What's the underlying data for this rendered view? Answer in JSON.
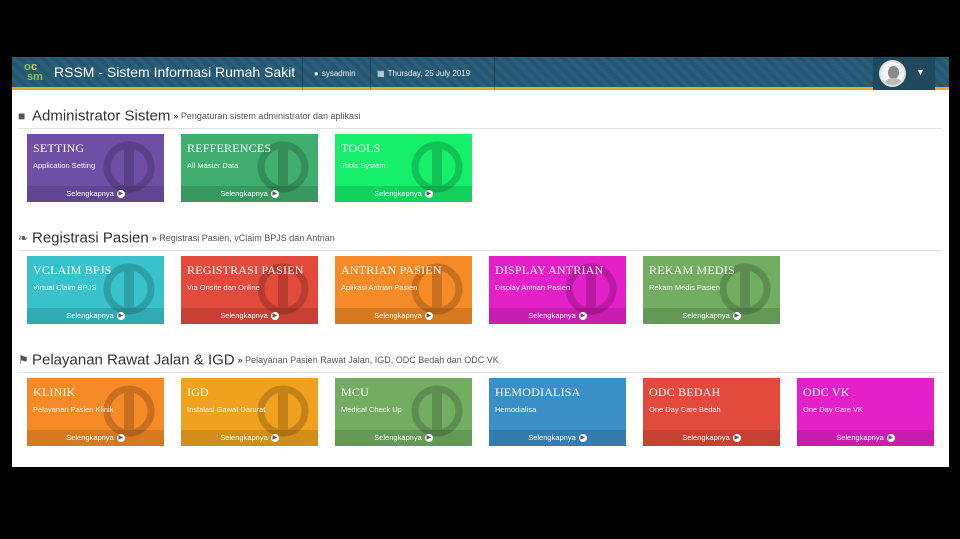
{
  "app": {
    "logo_text": "sm",
    "title": "RSSM - Sistem Informasi Rumah Sakit",
    "user_icon": "user-icon",
    "user": "sysadmin",
    "date_icon": "calendar-icon",
    "date": "Thursday, 25 July 2019"
  },
  "more_label": "Selengkapnya",
  "sections": [
    {
      "icon": "bookmark-icon",
      "title": "Administrator Sistem",
      "subtitle": "Pengaturan sistem administrator dan aplikasi",
      "tiles": [
        {
          "title": "SETTING",
          "sub": "Application Setting",
          "color": "#6f4fa5",
          "icon": "gears-icon"
        },
        {
          "title": "REFFERENCES",
          "sub": "All Master Data",
          "color": "#3fae6e",
          "icon": "table-icon"
        },
        {
          "title": "TOOLS",
          "sub": "Tools System",
          "color": "#15ef6a",
          "icon": "tools-icon"
        }
      ]
    },
    {
      "icon": "leaf-icon",
      "title": "Registrasi Pasien",
      "subtitle": "Registrasi Pasien, vClaim BPJS dan Antrian",
      "tiles": [
        {
          "title": "VCLAIM BPJS",
          "sub": "Virtual Claim BPJS",
          "color": "#38c3cc",
          "icon": "globe-icon"
        },
        {
          "title": "REGISTRASI PASIEN",
          "sub": "Via Onsite dan Online",
          "color": "#e24b3b",
          "icon": "edit-icon"
        },
        {
          "title": "ANTRIAN PASIEN",
          "sub": "Aplikasi Antrian Pasien",
          "color": "#f58a26",
          "icon": "list-icon"
        },
        {
          "title": "DISPLAY ANTRIAN",
          "sub": "Display Antrian Pasien",
          "color": "#e421c8",
          "icon": "monitor-icon"
        },
        {
          "title": "REKAM MEDIS",
          "sub": "Rekam Medis Pasien",
          "color": "#72ad62",
          "icon": "stethoscope-icon"
        }
      ]
    },
    {
      "icon": "flag-icon",
      "title": "Pelayanan Rawat Jalan & IGD",
      "subtitle": "Pelayanan Pasien Rawat Jalan, IGD, ODC Bedah dan ODC VK",
      "tiles": [
        {
          "title": "KLINIK",
          "sub": "Pelayanan Pasien Klinik",
          "color": "#f58a26",
          "icon": "asterisk-icon"
        },
        {
          "title": "IGD",
          "sub": "Instalasi Gawat Darurat",
          "color": "#f0a11e",
          "icon": "bookmark-icon"
        },
        {
          "title": "MCU",
          "sub": "Medical Check Up",
          "color": "#72ad62",
          "icon": "stethoscope-icon"
        },
        {
          "title": "HEMODIALISA",
          "sub": "Hemodialisa",
          "color": "#3a8fc6",
          "icon": "none"
        },
        {
          "title": "ODC BEDAH",
          "sub": "One Day Care Bedah",
          "color": "#e24b3b",
          "icon": "none"
        },
        {
          "title": "ODC VK",
          "sub": "One Day Care VK",
          "color": "#e421c8",
          "icon": "none"
        }
      ]
    }
  ]
}
